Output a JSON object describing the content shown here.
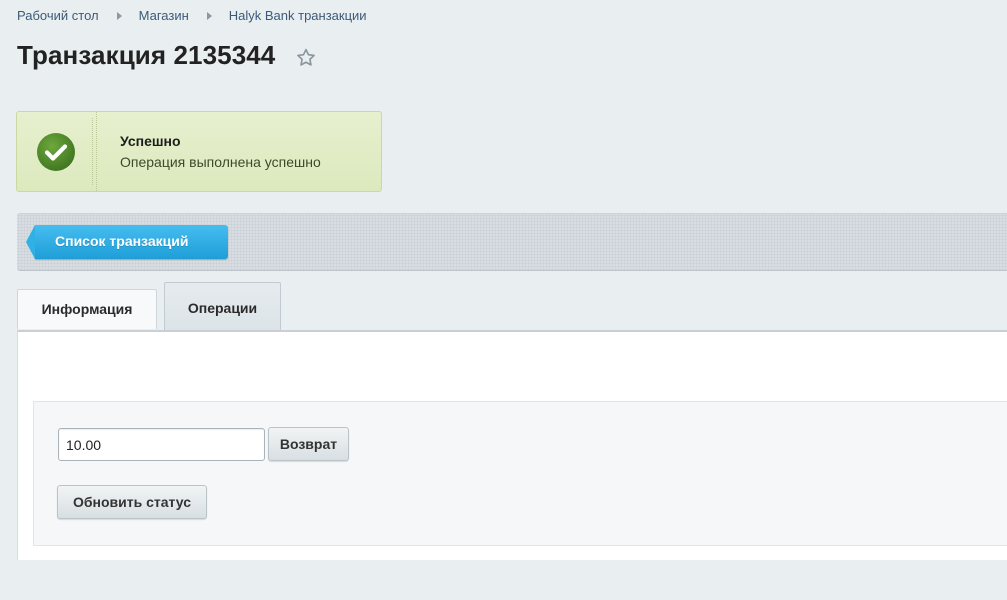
{
  "breadcrumb": {
    "items": [
      "Рабочий стол",
      "Магазин",
      "Halyk Bank транзакции"
    ]
  },
  "page": {
    "title": "Транзакция 2135344"
  },
  "alert": {
    "title": "Успешно",
    "message": "Операция выполнена успешно",
    "icon": "check-icon",
    "color": "#4d8a2c"
  },
  "toolbar": {
    "back_label": "Список транзакций",
    "accent": "#2ba6e0"
  },
  "tabs": [
    {
      "label": "Информация",
      "active": false
    },
    {
      "label": "Операции",
      "active": true
    }
  ],
  "operations": {
    "amount_value": "10.00",
    "refund_label": "Возврат",
    "refresh_label": "Обновить статус"
  }
}
